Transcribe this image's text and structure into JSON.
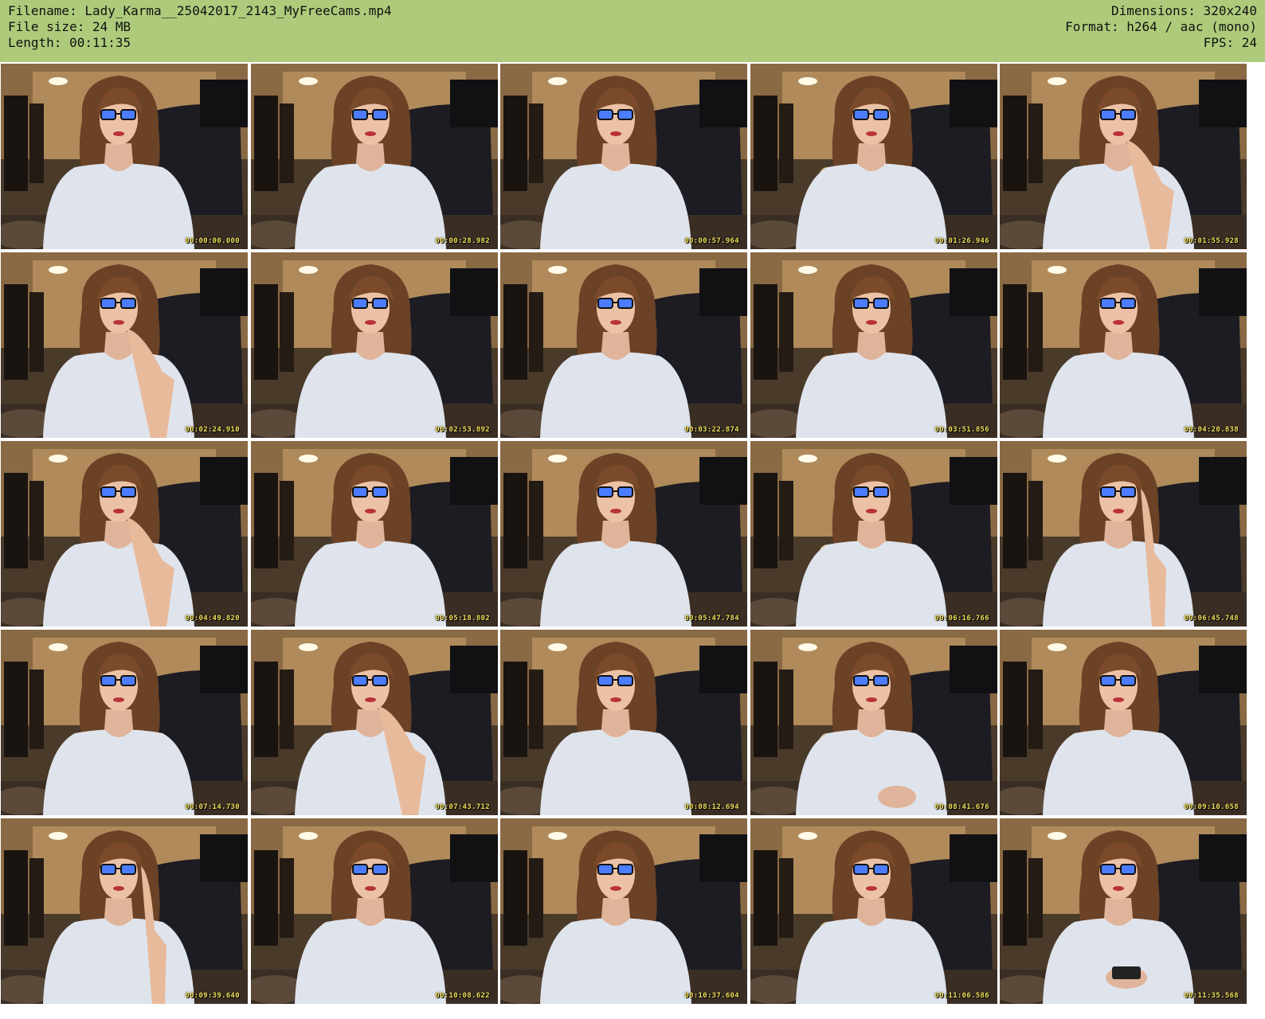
{
  "header": {
    "filename_line": "Filename: Lady_Karma__25042017_2143_MyFreeCams.mp4",
    "filesize_line": "File size: 24 MB",
    "length_line": "Length: 00:11:35",
    "dimensions_line": "Dimensions: 320x240",
    "format_line": "Format: h264 / aac (mono)",
    "fps_line": "FPS: 24"
  },
  "colors": {
    "header_bg": "#aecb7b",
    "timestamp": "#f1df5b"
  },
  "frame_icon": "webcam-frame-image",
  "frames": [
    {
      "timestamp": "00:00:00.000",
      "pose": "smile"
    },
    {
      "timestamp": "00:00:28.982",
      "pose": "smile"
    },
    {
      "timestamp": "00:00:57.964",
      "pose": "smile"
    },
    {
      "timestamp": "00:01:26.946",
      "pose": "smile"
    },
    {
      "timestamp": "00:01:55.928",
      "pose": "hand-chin"
    },
    {
      "timestamp": "00:02:24.910",
      "pose": "hand-chin"
    },
    {
      "timestamp": "00:02:53.892",
      "pose": "smile"
    },
    {
      "timestamp": "00:03:22.874",
      "pose": "smile"
    },
    {
      "timestamp": "00:03:51.856",
      "pose": "smile"
    },
    {
      "timestamp": "00:04:20.838",
      "pose": "smile"
    },
    {
      "timestamp": "00:04:49.820",
      "pose": "hand-chin"
    },
    {
      "timestamp": "00:05:18.802",
      "pose": "smile"
    },
    {
      "timestamp": "00:05:47.784",
      "pose": "smile"
    },
    {
      "timestamp": "00:06:16.766",
      "pose": "smile"
    },
    {
      "timestamp": "00:06:45.748",
      "pose": "hand-ear"
    },
    {
      "timestamp": "00:07:14.730",
      "pose": "smile"
    },
    {
      "timestamp": "00:07:43.712",
      "pose": "hand-chin"
    },
    {
      "timestamp": "00:08:12.694",
      "pose": "smile"
    },
    {
      "timestamp": "00:08:41.676",
      "pose": "hand-low"
    },
    {
      "timestamp": "00:09:10.658",
      "pose": "smile"
    },
    {
      "timestamp": "00:09:39.640",
      "pose": "hand-ear"
    },
    {
      "timestamp": "00:10:08.622",
      "pose": "smile"
    },
    {
      "timestamp": "00:10:37.604",
      "pose": "smile"
    },
    {
      "timestamp": "00:11:06.586",
      "pose": "smile"
    },
    {
      "timestamp": "00:11:35.568",
      "pose": "phone"
    }
  ]
}
